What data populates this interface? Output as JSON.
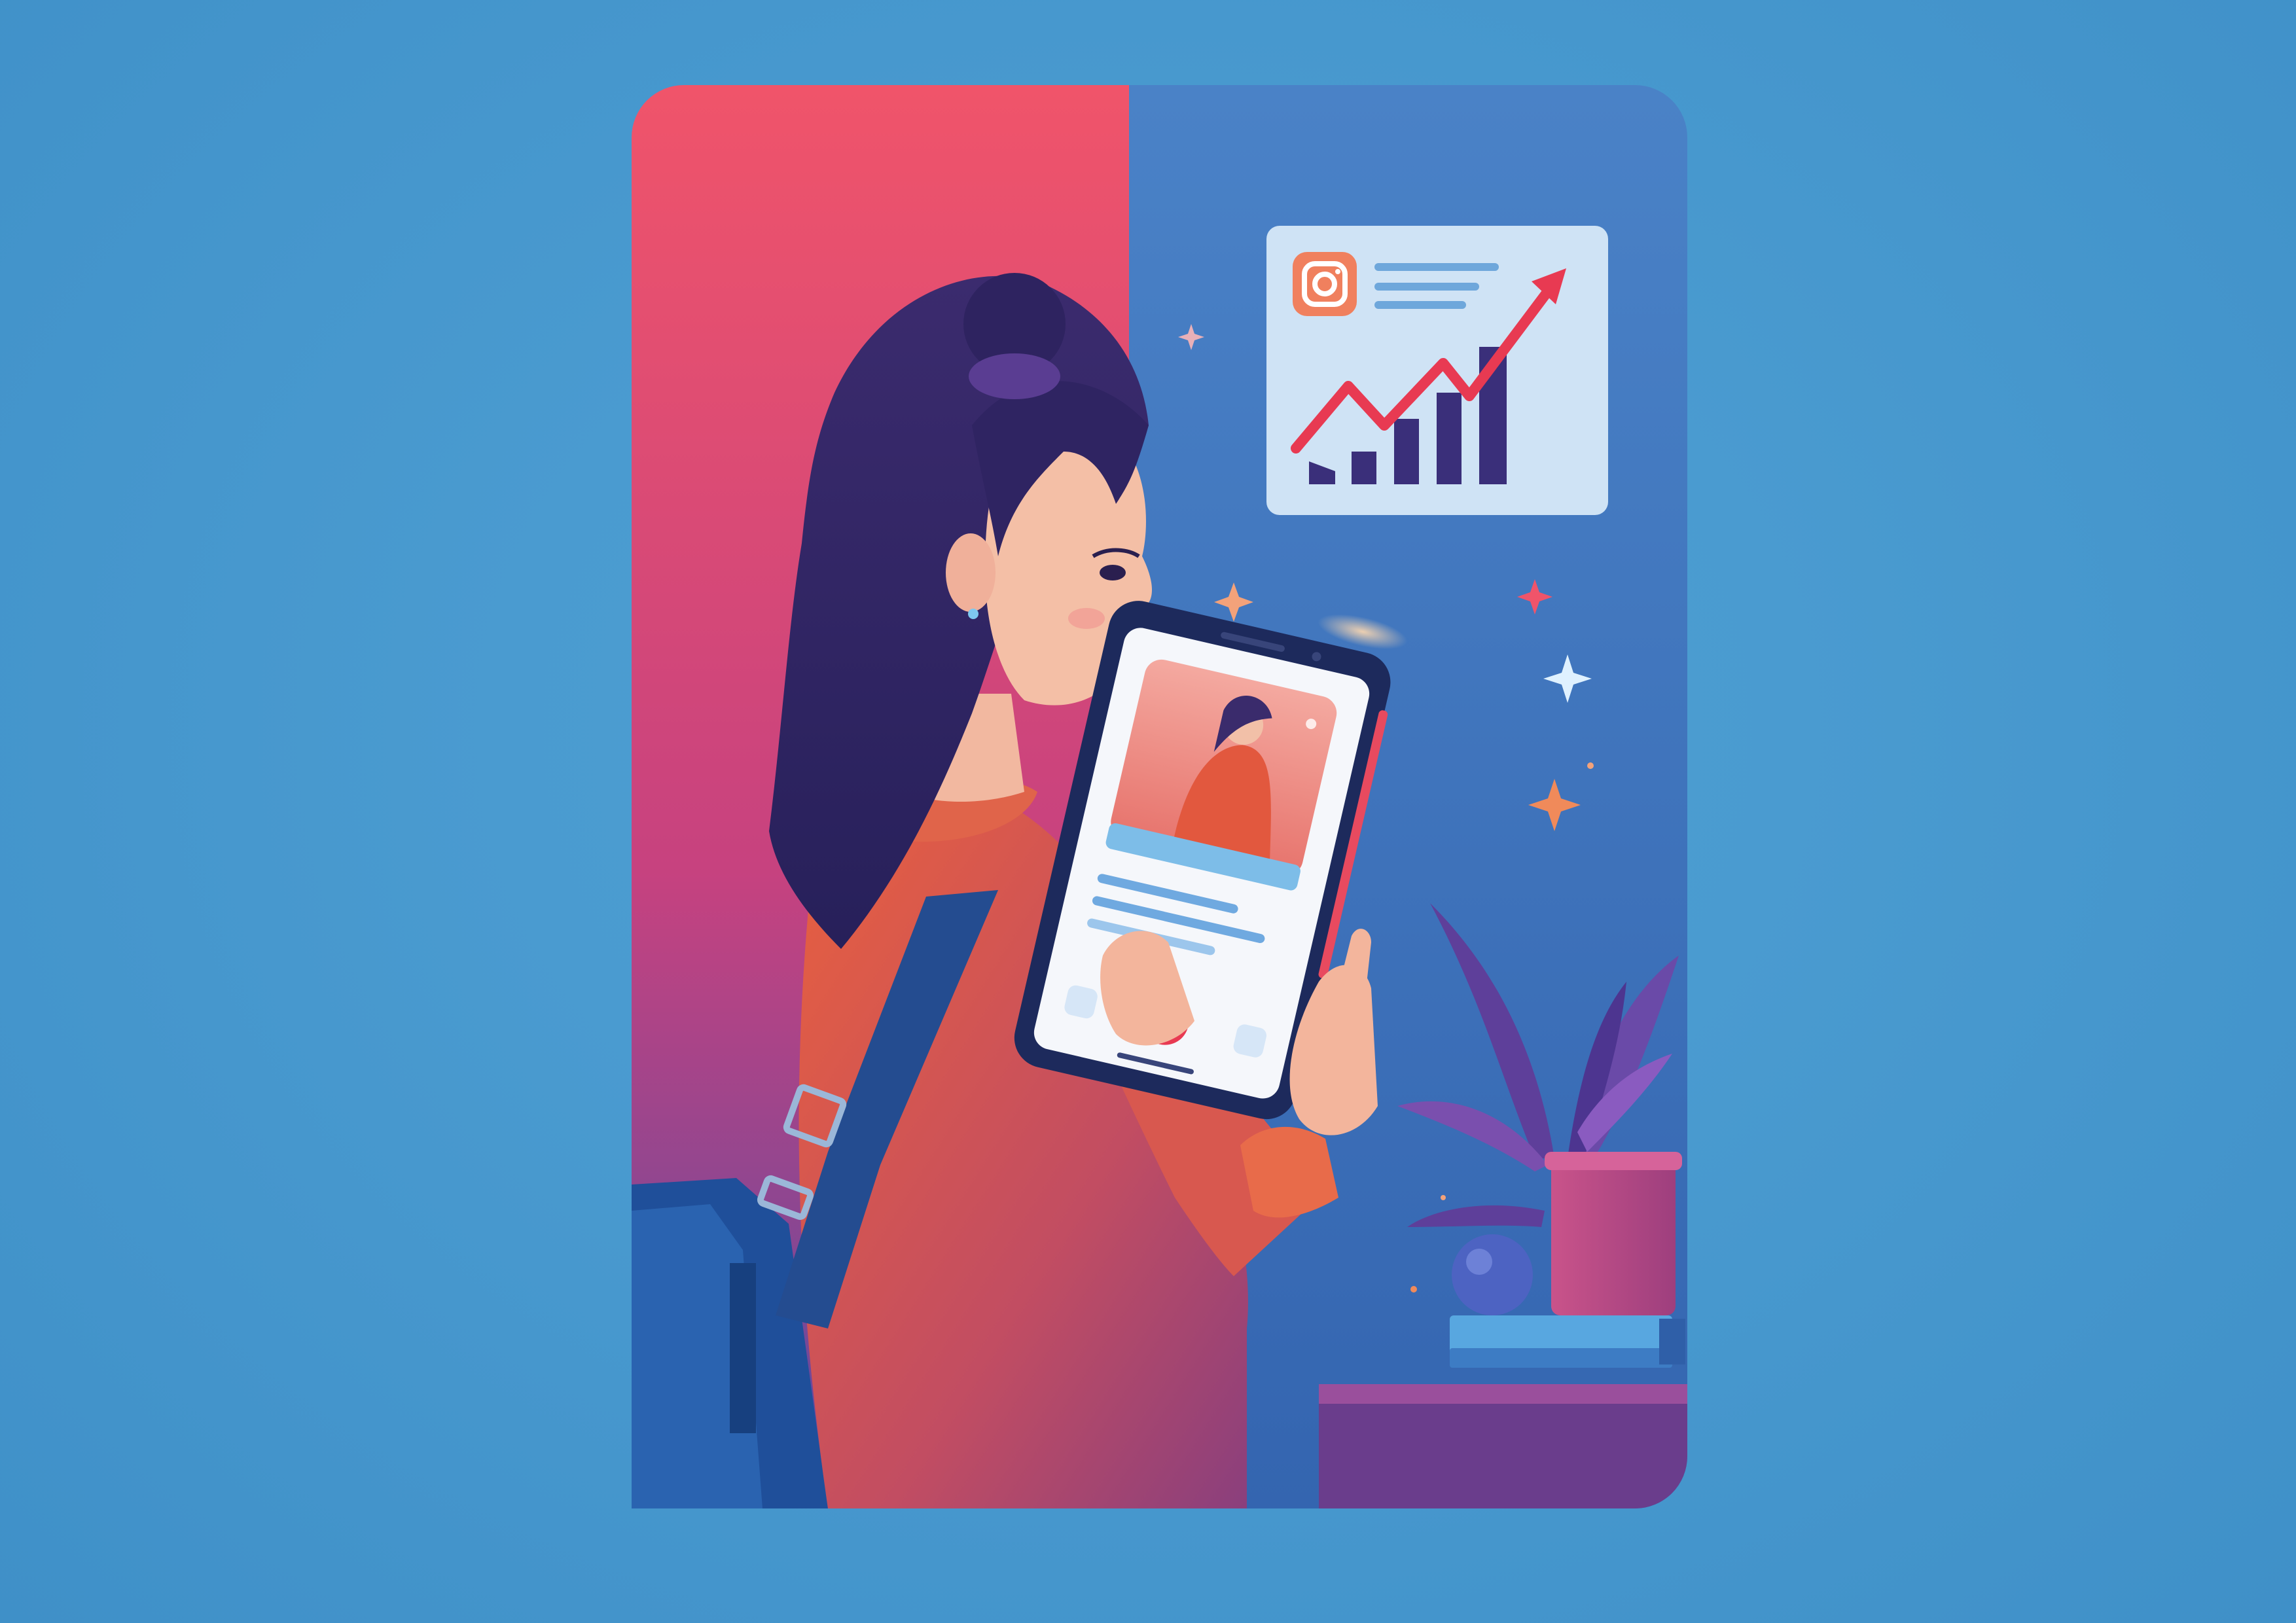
{
  "scene": {
    "background_color": "#4a9bd0",
    "panel_left_color": "#f0506f",
    "panel_right_color": "#3d7cc4",
    "icons": {
      "instagram": "instagram-logo-icon",
      "chart": "growth-chart-icon",
      "sparkle": "sparkle-icon",
      "plant": "potted-plant-icon",
      "phone": "smartphone-icon"
    }
  }
}
